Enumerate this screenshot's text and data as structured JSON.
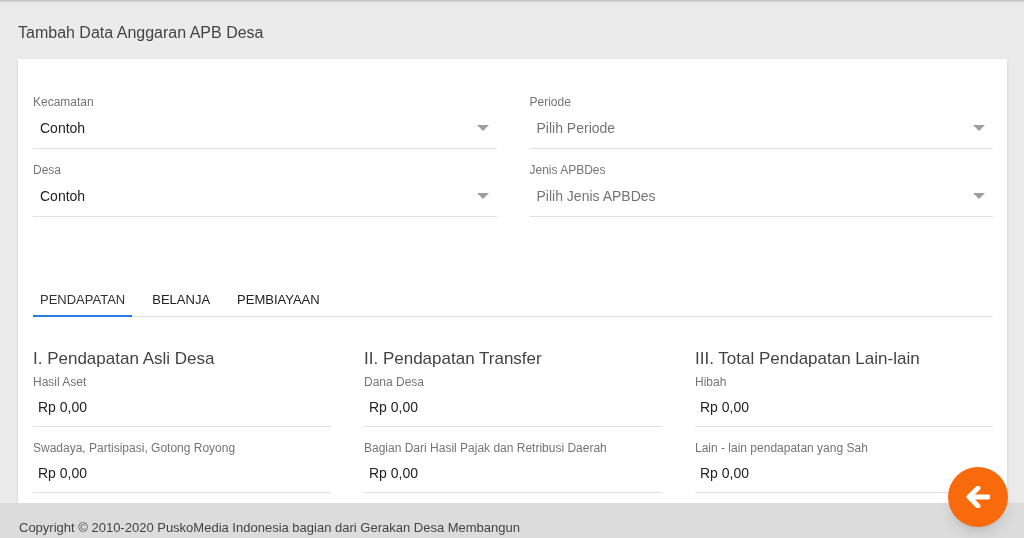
{
  "page_title": "Tambah Data Anggaran APB Desa",
  "selects": [
    {
      "label": "Kecamatan",
      "value": "Contoh"
    },
    {
      "label": "Periode",
      "placeholder": "Pilih Periode"
    },
    {
      "label": "Desa",
      "value": "Contoh"
    },
    {
      "label": "Jenis APBDes",
      "placeholder": "Pilih Jenis APBDes"
    }
  ],
  "tabs": [
    {
      "label": "PENDAPATAN",
      "selected": true
    },
    {
      "label": "BELANJA",
      "selected": false
    },
    {
      "label": "PEMBIAYAAN",
      "selected": false
    }
  ],
  "sections": [
    {
      "heading": "I. Pendapatan Asli Desa",
      "fields": [
        {
          "label": "Hasil Aset",
          "value": "Rp 0,00"
        },
        {
          "label": "Swadaya, Partisipasi, Gotong Royong",
          "value": "Rp 0,00"
        }
      ]
    },
    {
      "heading": "II. Pendapatan Transfer",
      "fields": [
        {
          "label": "Dana Desa",
          "value": "Rp 0,00"
        },
        {
          "label": "Bagian Dari Hasil Pajak dan Retribusi Daerah",
          "value": "Rp 0,00"
        }
      ]
    },
    {
      "heading": "III. Total Pendapatan Lain-lain",
      "fields": [
        {
          "label": "Hibah",
          "value": "Rp 0,00"
        },
        {
          "label": "Lain - lain pendapatan yang Sah",
          "value": "Rp 0,00"
        }
      ]
    }
  ],
  "footer": "Copyright © 2010-2020 PuskoMedia Indonesia bagian dari Gerakan Desa Membangun"
}
